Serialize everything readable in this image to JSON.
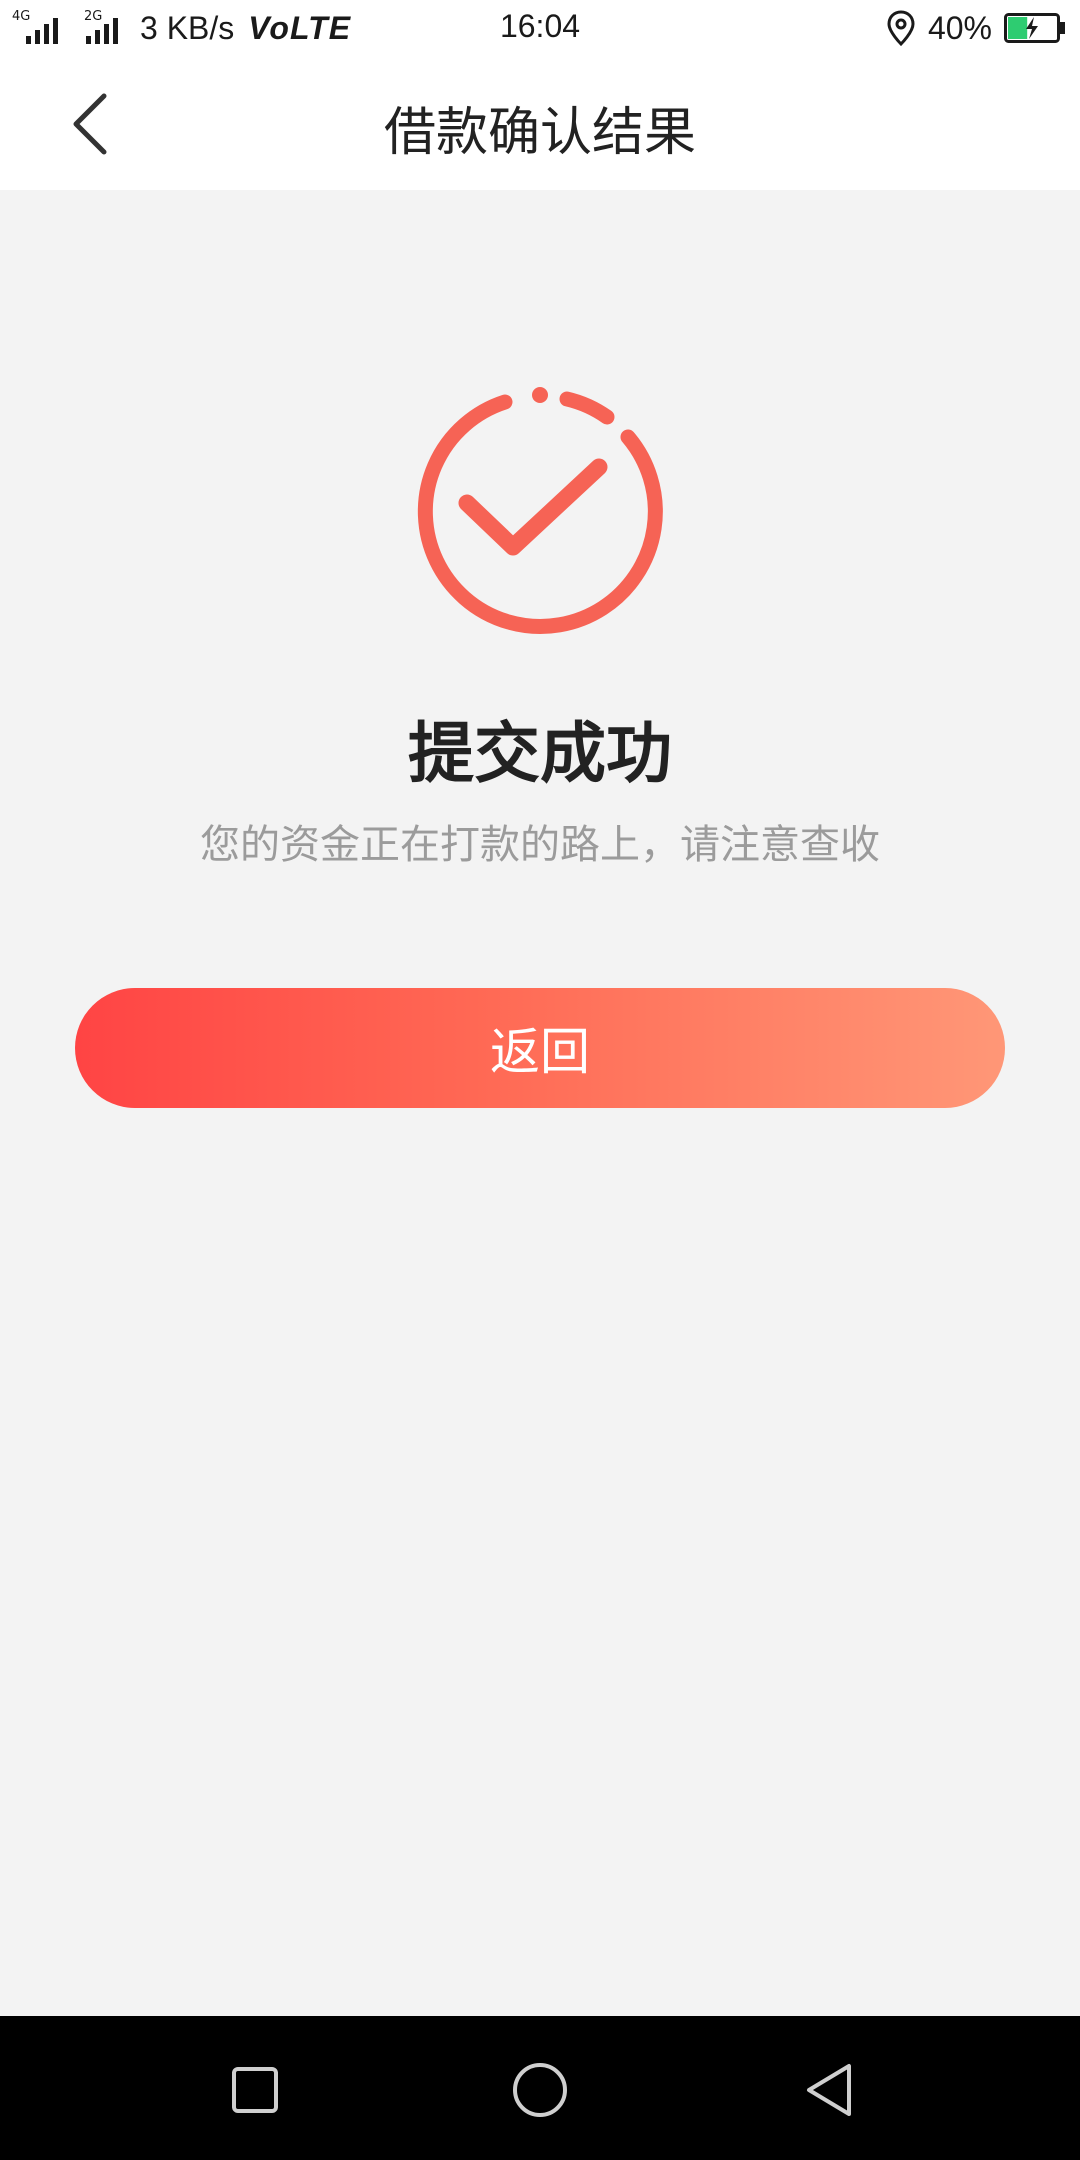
{
  "status_bar": {
    "signal1_tag": "4G",
    "signal2_tag": "2G",
    "net_speed": "3 KB/s",
    "volte": "VoLTE",
    "time": "16:04",
    "battery_percent": "40%",
    "battery_level": 0.4,
    "battery_color": "#2ecc71"
  },
  "header": {
    "title": "借款确认结果",
    "back_icon": "chevron-left-icon"
  },
  "result": {
    "icon": "check-circle-icon",
    "icon_color": "#f66355",
    "title": "提交成功",
    "description": "您的资金正在打款的路上，请注意查收"
  },
  "actions": {
    "return_label": "返回"
  },
  "nav_bar": {
    "recents_icon": "square-icon",
    "home_icon": "circle-icon",
    "back_icon": "triangle-back-icon"
  }
}
